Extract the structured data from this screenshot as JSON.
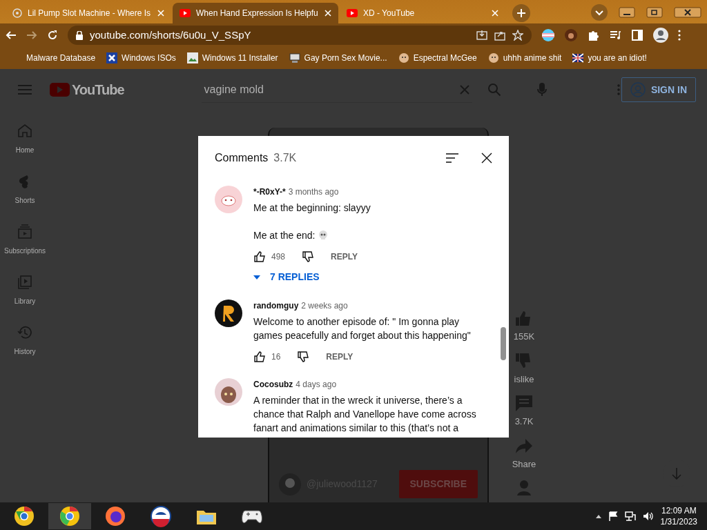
{
  "browser": {
    "tabs": [
      {
        "title": "Lil Pump Slot Machine - Where Is",
        "selected": false
      },
      {
        "title": "When Hand Expression Is Helpfu",
        "selected": true
      },
      {
        "title": "XD - YouTube",
        "selected": false
      }
    ],
    "address": "youtube.com/shorts/6u0u_V_SSpY",
    "bookmarks": [
      "Malware Database",
      "Windows ISOs",
      "Windows 11 Installer",
      "Gay Porn Sex Movie...",
      "Espectral McGee",
      "uhhh anime shit",
      "you are an idiot!"
    ]
  },
  "youtube": {
    "logo": "YouTube",
    "search_value": "vagine mold",
    "sign_in": "SIGN IN",
    "sidebar": [
      "Home",
      "Shorts",
      "Subscriptions",
      "Library",
      "History"
    ],
    "video": {
      "channel": "@juliewood1127",
      "subscribe": "SUBSCRIBE"
    },
    "actions": [
      "155K",
      "islike",
      "3.7K",
      "Share"
    ]
  },
  "comments_panel": {
    "title": "Comments",
    "count": "3.7K",
    "comments": [
      {
        "author": "*-R0xY-*",
        "time": "3 months ago",
        "paragraphs": [
          "Me at the beginning: slayyy",
          "Me at the end:"
        ],
        "likes": "498",
        "reply": "REPLY",
        "replies": "7 REPLIES"
      },
      {
        "author": "randomguy",
        "time": "2 weeks ago",
        "paragraphs": [
          "Welcome to another episode of: \" Im gonna play games peacefully and forget about this happening\""
        ],
        "likes": "16",
        "reply": "REPLY"
      },
      {
        "author": "Cocosubz",
        "time": "4 days ago",
        "paragraphs": [
          "A reminder that in the wreck it universe, there’s a chance that Ralph and Vanellope have come across fanart and animations similar to this (that’s not a"
        ]
      }
    ]
  },
  "taskbar": {
    "apps": [
      {
        "selected": false
      },
      {
        "selected": true
      },
      {
        "selected": false
      },
      {
        "selected": false
      },
      {
        "selected": false
      },
      {
        "selected": false
      }
    ],
    "time": "12:09 AM",
    "date": "1/31/2023"
  }
}
